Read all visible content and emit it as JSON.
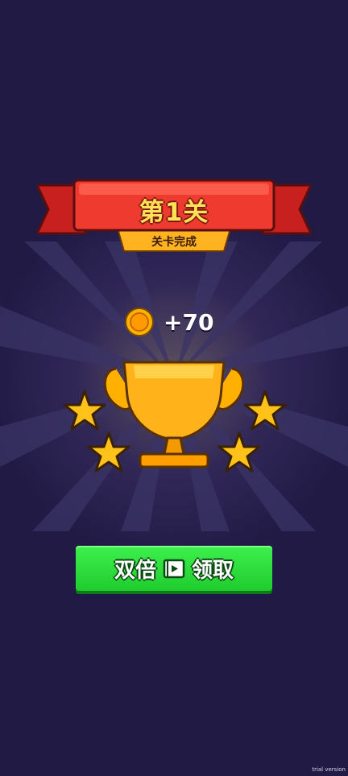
{
  "level_banner": {
    "title": "第1关",
    "subtitle": "关卡完成"
  },
  "reward": {
    "icon": "gold-coin-icon",
    "amount": "+70"
  },
  "trophy": {
    "icon": "gold-trophy-icon"
  },
  "stars": {
    "earned": 4,
    "icon": "gold-star-icon"
  },
  "claim_button": {
    "label_left": "双倍",
    "icon": "video-ad-icon",
    "label_right": "领取"
  },
  "watermark": "trial version",
  "colors": {
    "background": "#211a45",
    "banner_red": "#e8302b",
    "banner_gold": "#ffb321",
    "button_green": "#2ee23c",
    "coin_gold": "#ffb000"
  }
}
